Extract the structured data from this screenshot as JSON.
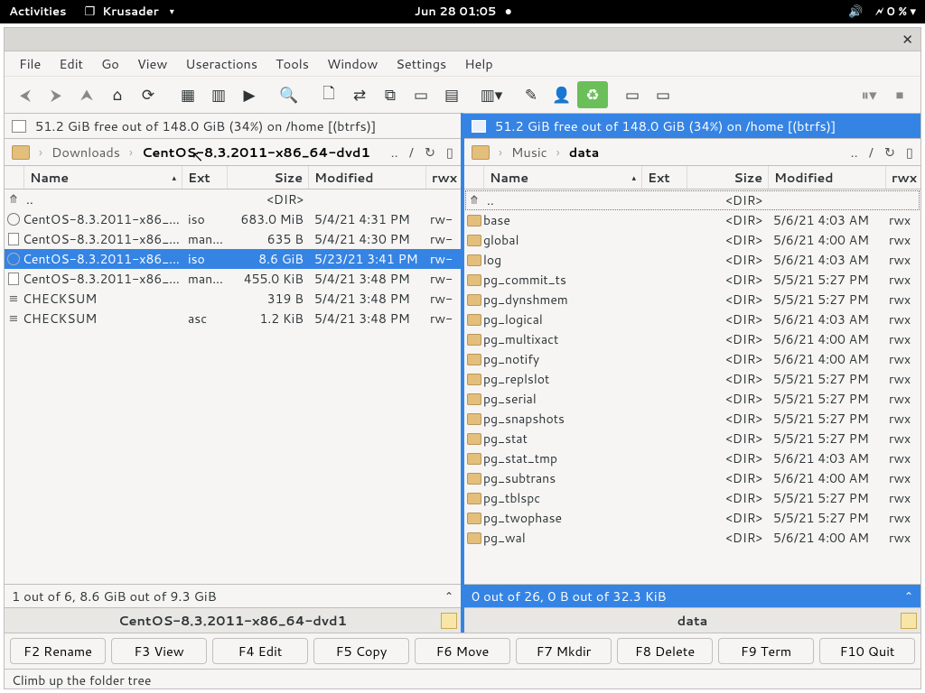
{
  "topbar": {
    "activities": "Activities",
    "app_name": "Krusader",
    "clock": "Jun 28  01:05",
    "battery": "0 %"
  },
  "menus": [
    "File",
    "Edit",
    "Go",
    "View",
    "Useractions",
    "Tools",
    "Window",
    "Settings",
    "Help"
  ],
  "disk_info": "51.2 GiB free out of 148.0 GiB (34%) on /home [(btrfs)]",
  "left": {
    "crumbs": [
      "Downloads",
      "CentOS-8.3.2011-x86_64-dvd1"
    ],
    "updots": "..",
    "cols": [
      "Name",
      "Ext",
      "Size",
      "Modified",
      "rwx"
    ],
    "up": {
      "name": "..",
      "size": "<DIR>"
    },
    "rows": [
      {
        "ic": "iso",
        "name": "CentOS-8.3.2011-x86_…",
        "ext": "iso",
        "size": "683.0 MiB",
        "mod": "5/4/21 4:31 PM",
        "rwx": "rw-",
        "sel": false
      },
      {
        "ic": "file",
        "name": "CentOS-8.3.2011-x86_…",
        "ext": "man…",
        "size": "635 B",
        "mod": "5/4/21 4:30 PM",
        "rwx": "rw-",
        "sel": false
      },
      {
        "ic": "iso",
        "name": "CentOS-8.3.2011-x86_…",
        "ext": "iso",
        "size": "8.6 GiB",
        "mod": "5/23/21 3:41 PM",
        "rwx": "rw-",
        "sel": true
      },
      {
        "ic": "file",
        "name": "CentOS-8.3.2011-x86_…",
        "ext": "man…",
        "size": "455.0 KiB",
        "mod": "5/4/21 3:48 PM",
        "rwx": "rw-",
        "sel": false
      },
      {
        "ic": "txt",
        "name": "CHECKSUM",
        "ext": "",
        "size": "319 B",
        "mod": "5/4/21 3:48 PM",
        "rwx": "rw-",
        "sel": false
      },
      {
        "ic": "txt",
        "name": "CHECKSUM",
        "ext": "asc",
        "size": "1.2 KiB",
        "mod": "5/4/21 3:48 PM",
        "rwx": "rw-",
        "sel": false
      }
    ],
    "status": "1 out of 6, 8.6 GiB out of 9.3 GiB",
    "tab": "CentOS-8.3.2011-x86_64-dvd1"
  },
  "right": {
    "crumbs": [
      "Music",
      "data"
    ],
    "updots": "..",
    "cols": [
      "Name",
      "Ext",
      "Size",
      "Modified",
      "rwx"
    ],
    "up": {
      "name": "..",
      "size": "<DIR>"
    },
    "rows": [
      {
        "name": "base",
        "size": "<DIR>",
        "mod": "5/6/21 4:03 AM",
        "rwx": "rwx"
      },
      {
        "name": "global",
        "size": "<DIR>",
        "mod": "5/6/21 4:00 AM",
        "rwx": "rwx"
      },
      {
        "name": "log",
        "size": "<DIR>",
        "mod": "5/6/21 4:03 AM",
        "rwx": "rwx"
      },
      {
        "name": "pg_commit_ts",
        "size": "<DIR>",
        "mod": "5/5/21 5:27 PM",
        "rwx": "rwx"
      },
      {
        "name": "pg_dynshmem",
        "size": "<DIR>",
        "mod": "5/5/21 5:27 PM",
        "rwx": "rwx"
      },
      {
        "name": "pg_logical",
        "size": "<DIR>",
        "mod": "5/6/21 4:03 AM",
        "rwx": "rwx"
      },
      {
        "name": "pg_multixact",
        "size": "<DIR>",
        "mod": "5/6/21 4:00 AM",
        "rwx": "rwx"
      },
      {
        "name": "pg_notify",
        "size": "<DIR>",
        "mod": "5/6/21 4:00 AM",
        "rwx": "rwx"
      },
      {
        "name": "pg_replslot",
        "size": "<DIR>",
        "mod": "5/5/21 5:27 PM",
        "rwx": "rwx"
      },
      {
        "name": "pg_serial",
        "size": "<DIR>",
        "mod": "5/5/21 5:27 PM",
        "rwx": "rwx"
      },
      {
        "name": "pg_snapshots",
        "size": "<DIR>",
        "mod": "5/5/21 5:27 PM",
        "rwx": "rwx"
      },
      {
        "name": "pg_stat",
        "size": "<DIR>",
        "mod": "5/5/21 5:27 PM",
        "rwx": "rwx"
      },
      {
        "name": "pg_stat_tmp",
        "size": "<DIR>",
        "mod": "5/6/21 4:03 AM",
        "rwx": "rwx"
      },
      {
        "name": "pg_subtrans",
        "size": "<DIR>",
        "mod": "5/6/21 4:00 AM",
        "rwx": "rwx"
      },
      {
        "name": "pg_tblspc",
        "size": "<DIR>",
        "mod": "5/5/21 5:27 PM",
        "rwx": "rwx"
      },
      {
        "name": "pg_twophase",
        "size": "<DIR>",
        "mod": "5/5/21 5:27 PM",
        "rwx": "rwx"
      },
      {
        "name": "pg_wal",
        "size": "<DIR>",
        "mod": "5/6/21 4:00 AM",
        "rwx": "rwx"
      }
    ],
    "status": "0 out of 26, 0 B out of 32.3 KiB",
    "tab": "data"
  },
  "fkeys": [
    "F2 Rename",
    "F3 View",
    "F4 Edit",
    "F5 Copy",
    "F6 Move",
    "F7 Mkdir",
    "F8 Delete",
    "F9 Term",
    "F10 Quit"
  ],
  "hint": "Climb up the folder tree"
}
